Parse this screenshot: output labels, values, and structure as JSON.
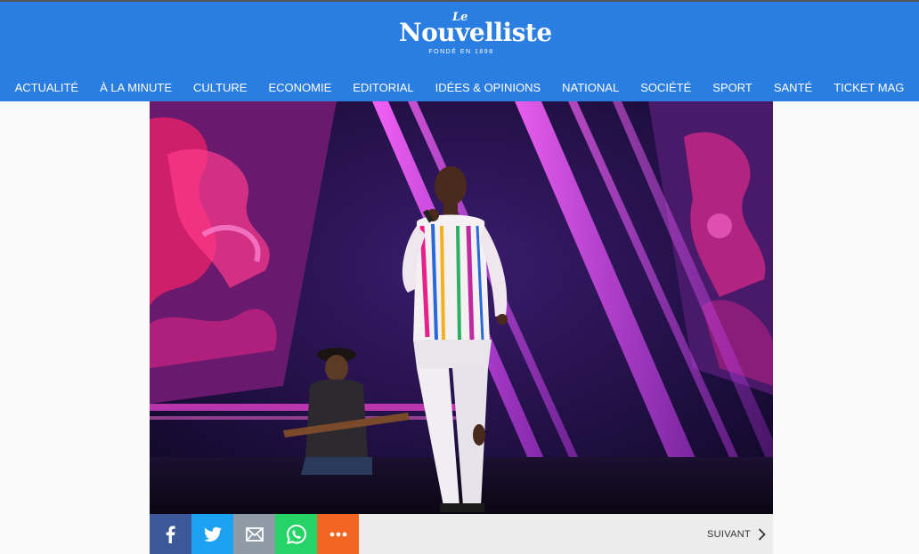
{
  "header": {
    "logo_le": "Le",
    "logo_name": "Nouvelliste",
    "logo_tagline": "FONDÉ EN 1898",
    "bg_color": "#2a7de1"
  },
  "nav": {
    "items": [
      {
        "label": "ACTUALITÉ"
      },
      {
        "label": "À LA MINUTE"
      },
      {
        "label": "CULTURE"
      },
      {
        "label": "ECONOMIE"
      },
      {
        "label": "EDITORIAL"
      },
      {
        "label": "IDÉES & OPINIONS"
      },
      {
        "label": "NATIONAL"
      },
      {
        "label": "SOCIÉTÉ"
      },
      {
        "label": "SPORT"
      },
      {
        "label": "SANTÉ"
      },
      {
        "label": "TICKET MAG"
      }
    ]
  },
  "hero": {
    "subject": "singer-on-stage-photo"
  },
  "share": {
    "buttons": [
      {
        "icon": "facebook-icon",
        "color": "#3b5998"
      },
      {
        "icon": "twitter-icon",
        "color": "#1da1f2"
      },
      {
        "icon": "email-icon",
        "color": "#8e9ba6"
      },
      {
        "icon": "whatsapp-icon",
        "color": "#25d366"
      },
      {
        "icon": "more-icon",
        "color": "#f26522"
      }
    ],
    "next_label": "SUIVANT"
  }
}
